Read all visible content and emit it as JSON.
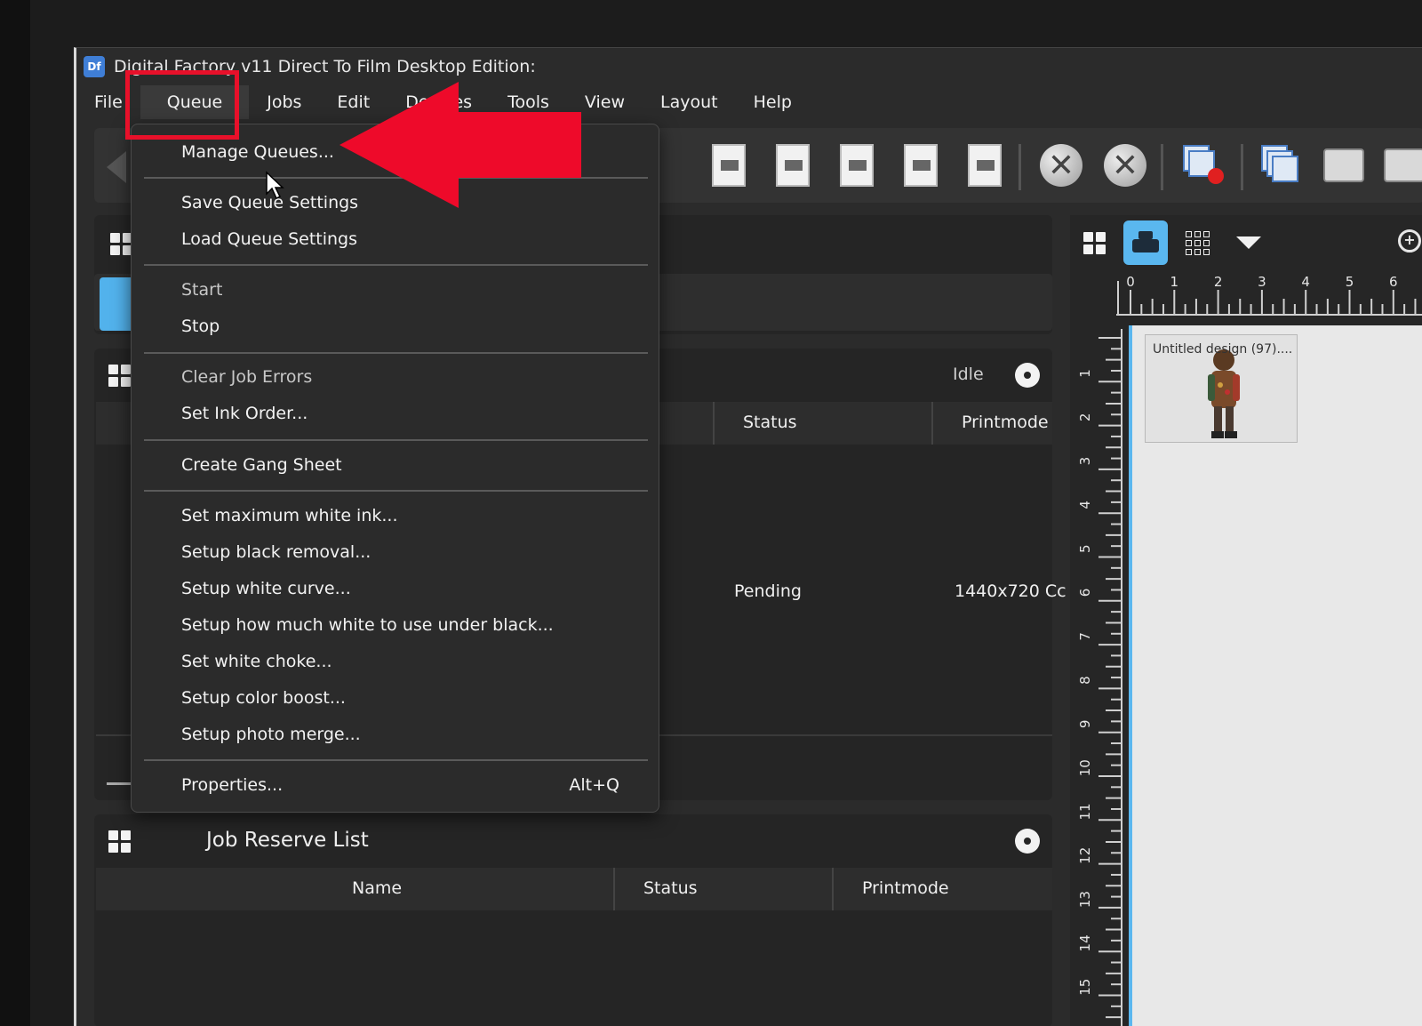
{
  "window": {
    "title": "Digital Factory v11 Direct To Film Desktop Edition:"
  },
  "menubar": [
    "File",
    "Queue",
    "Jobs",
    "Edit",
    "Devices",
    "Tools",
    "View",
    "Layout",
    "Help"
  ],
  "queue_menu": {
    "group1": [
      "Manage Queues..."
    ],
    "group2": [
      "Save Queue Settings",
      "Load Queue Settings"
    ],
    "group3": [
      "Start",
      "Stop"
    ],
    "group4": [
      "Clear Job Errors",
      "Set Ink Order..."
    ],
    "group5": [
      "Create Gang Sheet"
    ],
    "group6": [
      "Set maximum white ink...",
      "Setup black removal...",
      "Setup white curve...",
      "Setup how much white to use under black...",
      "Set white choke...",
      "Setup color boost...",
      "Setup photo merge..."
    ],
    "properties": {
      "label": "Properties...",
      "shortcut": "Alt+Q"
    }
  },
  "queue_panel": {
    "state": "Idle",
    "columns": [
      "Status",
      "Printmode"
    ],
    "row": {
      "status": "Pending",
      "printmode": "1440x720 Cc"
    }
  },
  "reserve_panel": {
    "title": "Job Reserve List",
    "columns": [
      "Name",
      "Status",
      "Printmode"
    ]
  },
  "layout_view": {
    "thumbnail_label": "Untitled design (97)....",
    "hruler_labels": [
      "0",
      "1",
      "2",
      "3",
      "4",
      "5",
      "6"
    ],
    "vruler_labels": [
      "1",
      "2",
      "3",
      "4",
      "5",
      "6",
      "7",
      "8",
      "9",
      "10",
      "11",
      "12",
      "13",
      "14",
      "15"
    ]
  },
  "icons": {
    "app": "app-icon",
    "menu_cursor": "mouse-pointer-icon",
    "annotation": "red-arrow-icon"
  },
  "colors": {
    "highlight": "#e8102a",
    "accent": "#5ab7ef"
  }
}
